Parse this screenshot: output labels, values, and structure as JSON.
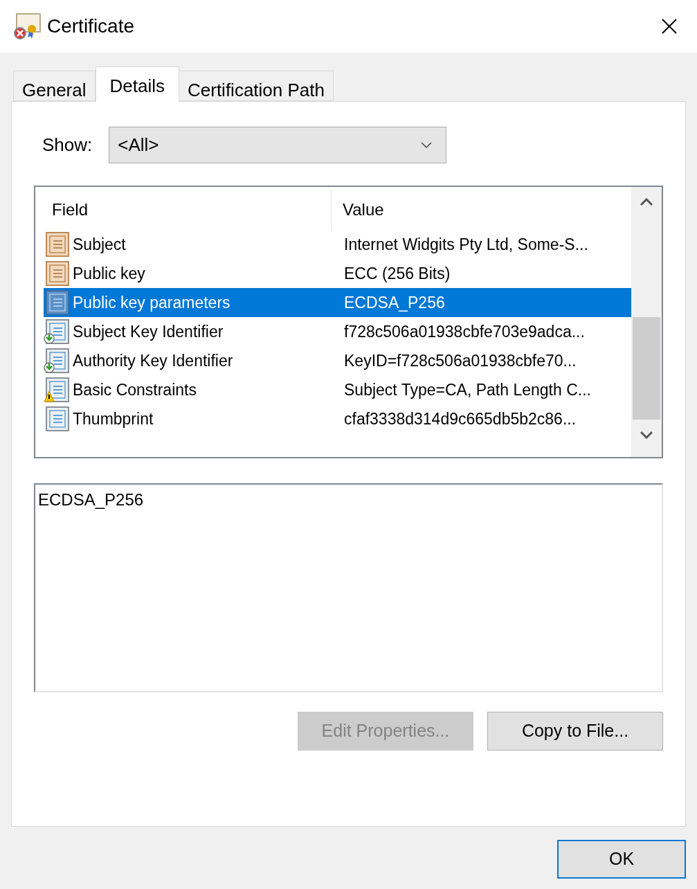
{
  "window": {
    "title": "Certificate"
  },
  "tabs": [
    {
      "label": "General",
      "selected": false
    },
    {
      "label": "Details",
      "selected": true
    },
    {
      "label": "Certification Path",
      "selected": false
    }
  ],
  "show": {
    "label": "Show:",
    "value": "<All>"
  },
  "table": {
    "columns": [
      "Field",
      "Value"
    ],
    "rows": [
      {
        "kind": "field",
        "field": "Subject",
        "value": "Internet Widgits Pty Ltd, Some-S...",
        "selected": false
      },
      {
        "kind": "field",
        "field": "Public key",
        "value": "ECC (256 Bits)",
        "selected": false
      },
      {
        "kind": "field",
        "field": "Public key parameters",
        "value": "ECDSA_P256",
        "selected": true
      },
      {
        "kind": "extension",
        "field": "Subject Key Identifier",
        "value": "f728c506a01938cbfe703e9adca...",
        "selected": false
      },
      {
        "kind": "extension",
        "field": "Authority Key Identifier",
        "value": "KeyID=f728c506a01938cbfe70...",
        "selected": false
      },
      {
        "kind": "critical",
        "field": "Basic Constraints",
        "value": "Subject Type=CA, Path Length C...",
        "selected": false
      },
      {
        "kind": "property",
        "field": "Thumbprint",
        "value": "cfaf3338d314d9c665db5b2c86...",
        "selected": false
      }
    ]
  },
  "detail_text": "ECDSA_P256",
  "buttons": [
    {
      "label": "Edit Properties...",
      "disabled": true
    },
    {
      "label": "Copy to File...",
      "disabled": false
    }
  ],
  "ok_button": "OK"
}
